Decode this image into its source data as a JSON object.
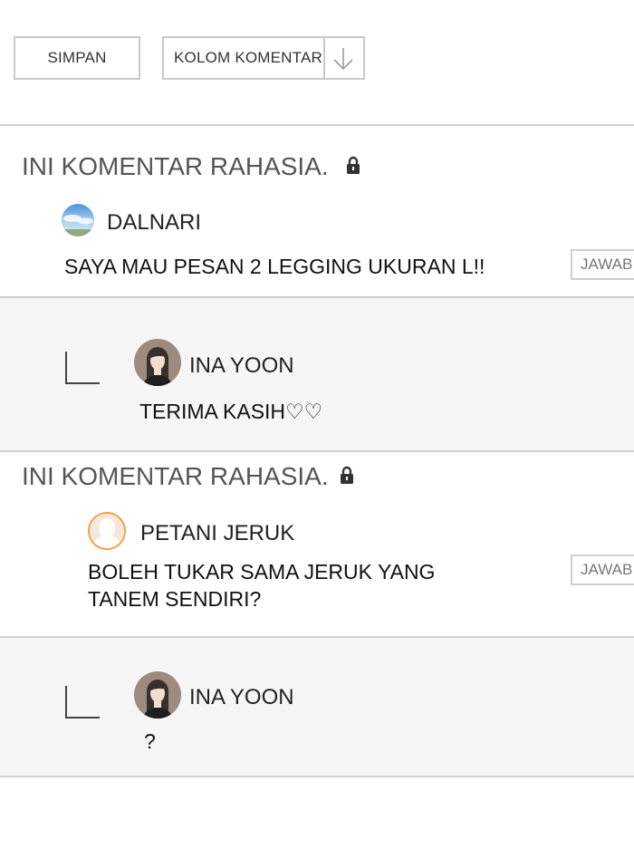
{
  "toolbar": {
    "save_label": "SIMPAN",
    "comment_column_label": "KOLOM KOMENTAR"
  },
  "comments": [
    {
      "secret_label": "INI KOMENTAR RAHASIA.",
      "author": "DALNARI",
      "text": "SAYA MAU PESAN 2 LEGGING UKURAN L!!",
      "reply_button": "JAWAB",
      "reply": {
        "author": "INA YOON",
        "text": "TERIMA KASIH♡♡"
      }
    },
    {
      "secret_label": "INI KOMENTAR RAHASIA.",
      "author": "PETANI JERUK",
      "text_lines": [
        "BOLEH TUKAR SAMA JERUK YANG",
        "TANEM SENDIRI?"
      ],
      "reply_button": "JAWAB",
      "reply": {
        "author": "INA YOON",
        "text": "?"
      }
    }
  ],
  "icons": {
    "lock": "lock-icon",
    "arrow": "arrow-down-icon",
    "reply_indicator": "reply-elbow-icon"
  },
  "colors": {
    "border": "#c9c9c9",
    "reply_background": "#f6f6f6",
    "secret_text": "#555555"
  }
}
